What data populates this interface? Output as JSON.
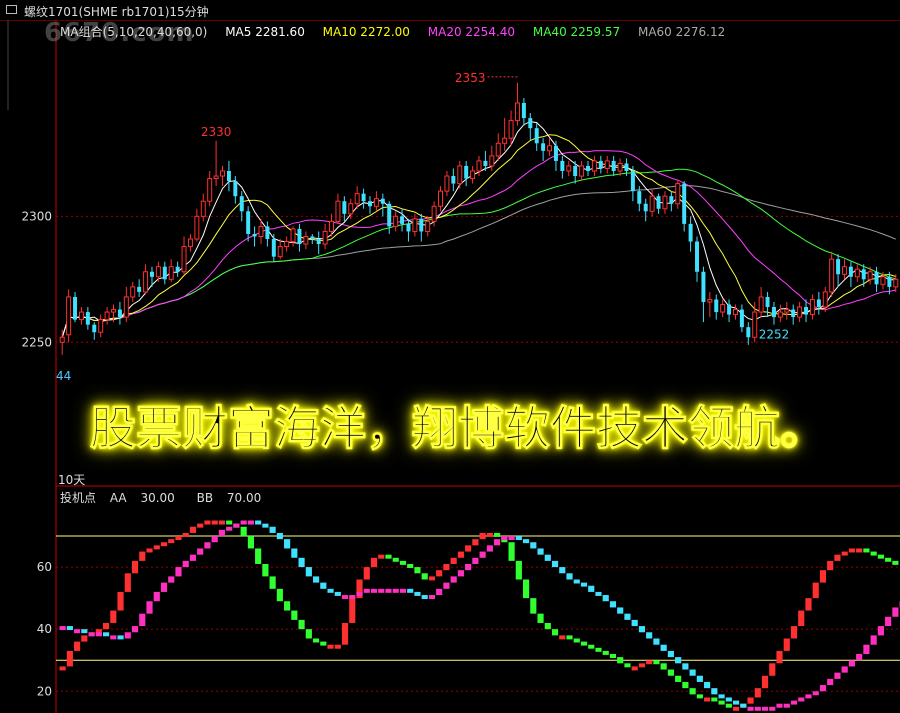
{
  "window": {
    "title": "螺纹1701(SHME rb1701)15分钟"
  },
  "watermark": "6670.com",
  "ma_legend": {
    "group_label": "MA组合(5,10,20,40,60,0)",
    "ma5": "MA5 2281.60",
    "ma10": "MA10 2272.00",
    "ma20": "MA20 2254.40",
    "ma40": "MA40 2259.57",
    "ma60": "MA60 2276.12"
  },
  "colors": {
    "up": "#ff3030",
    "down": "#40e0ff",
    "ma5": "#ffffff",
    "ma10": "#ffff40",
    "ma20": "#ff40ff",
    "ma40": "#40ff40",
    "ma60": "#a0a0a0",
    "axis": "#cc0000",
    "grid_dot": "#990000"
  },
  "banner_text": "股票财富海洋，翔博软件技术领航。",
  "days_label": "10天",
  "left_edge_tick": "44",
  "indicator_legend": {
    "name": "投机点",
    "aa_label": "AA",
    "aa_value": "30.00",
    "bb_label": "BB",
    "bb_value": "70.00"
  },
  "chart_data": [
    {
      "type": "candlestick",
      "title": "螺纹1701(SHME rb1701)15分钟",
      "y_ticks": [
        "2300",
        "2250"
      ],
      "ylim": [
        2239,
        2370
      ],
      "annotations": [
        {
          "label": "2330",
          "bar": 24
        },
        {
          "label": "2353",
          "bar": 71
        },
        {
          "label": "2252",
          "bar": 111
        }
      ],
      "candles": [
        [
          2250,
          2252,
          2245,
          2255
        ],
        [
          2253,
          2268,
          2250,
          2271
        ],
        [
          2268,
          2259,
          2258,
          2270
        ],
        [
          2259,
          2262,
          2257,
          2264
        ],
        [
          2262,
          2257,
          2255,
          2264
        ],
        [
          2257,
          2254,
          2251,
          2258
        ],
        [
          2254,
          2259,
          2252,
          2261
        ],
        [
          2259,
          2262,
          2257,
          2264
        ],
        [
          2262,
          2263,
          2258,
          2265
        ],
        [
          2263,
          2260,
          2257,
          2266
        ],
        [
          2260,
          2268,
          2258,
          2272
        ],
        [
          2268,
          2272,
          2266,
          2274
        ],
        [
          2272,
          2270,
          2268,
          2275
        ],
        [
          2270,
          2278,
          2269,
          2281
        ],
        [
          2278,
          2276,
          2272,
          2280
        ],
        [
          2276,
          2280,
          2274,
          2282
        ],
        [
          2280,
          2275,
          2273,
          2282
        ],
        [
          2275,
          2280,
          2274,
          2283
        ],
        [
          2280,
          2278,
          2276,
          2282
        ],
        [
          2278,
          2288,
          2277,
          2292
        ],
        [
          2288,
          2291,
          2286,
          2293
        ],
        [
          2291,
          2300,
          2290,
          2303
        ],
        [
          2300,
          2306,
          2298,
          2309
        ],
        [
          2306,
          2315,
          2304,
          2318
        ],
        [
          2315,
          2316,
          2312,
          2330
        ],
        [
          2316,
          2318,
          2312,
          2320
        ],
        [
          2318,
          2314,
          2310,
          2322
        ],
        [
          2314,
          2308,
          2305,
          2316
        ],
        [
          2308,
          2302,
          2298,
          2310
        ],
        [
          2302,
          2293,
          2290,
          2304
        ],
        [
          2293,
          2292,
          2288,
          2296
        ],
        [
          2292,
          2296,
          2289,
          2299
        ],
        [
          2296,
          2291,
          2288,
          2298
        ],
        [
          2291,
          2284,
          2282,
          2293
        ],
        [
          2284,
          2288,
          2283,
          2291
        ],
        [
          2288,
          2290,
          2286,
          2292
        ],
        [
          2290,
          2295,
          2288,
          2296
        ],
        [
          2295,
          2289,
          2286,
          2297
        ],
        [
          2289,
          2292,
          2287,
          2294
        ],
        [
          2292,
          2291,
          2289,
          2293
        ],
        [
          2291,
          2289,
          2285,
          2294
        ],
        [
          2289,
          2294,
          2287,
          2297
        ],
        [
          2294,
          2298,
          2292,
          2301
        ],
        [
          2298,
          2306,
          2297,
          2309
        ],
        [
          2306,
          2301,
          2298,
          2308
        ],
        [
          2301,
          2305,
          2299,
          2307
        ],
        [
          2305,
          2309,
          2303,
          2312
        ],
        [
          2309,
          2306,
          2303,
          2311
        ],
        [
          2306,
          2304,
          2301,
          2308
        ],
        [
          2304,
          2307,
          2302,
          2310
        ],
        [
          2307,
          2305,
          2300,
          2309
        ],
        [
          2305,
          2296,
          2293,
          2306
        ],
        [
          2296,
          2300,
          2294,
          2302
        ],
        [
          2300,
          2297,
          2294,
          2303
        ],
        [
          2297,
          2294,
          2290,
          2299
        ],
        [
          2294,
          2299,
          2292,
          2301
        ],
        [
          2299,
          2294,
          2290,
          2301
        ],
        [
          2294,
          2298,
          2292,
          2300
        ],
        [
          2298,
          2304,
          2296,
          2306
        ],
        [
          2304,
          2310,
          2302,
          2312
        ],
        [
          2310,
          2316,
          2308,
          2318
        ],
        [
          2316,
          2313,
          2310,
          2319
        ],
        [
          2313,
          2320,
          2311,
          2322
        ],
        [
          2320,
          2315,
          2312,
          2322
        ],
        [
          2315,
          2318,
          2313,
          2320
        ],
        [
          2318,
          2322,
          2316,
          2324
        ],
        [
          2322,
          2320,
          2318,
          2326
        ],
        [
          2320,
          2324,
          2318,
          2328
        ],
        [
          2324,
          2329,
          2322,
          2333
        ],
        [
          2329,
          2331,
          2326,
          2339
        ],
        [
          2331,
          2338,
          2328,
          2342
        ],
        [
          2338,
          2345,
          2336,
          2353
        ],
        [
          2345,
          2339,
          2336,
          2347
        ],
        [
          2339,
          2335,
          2330,
          2341
        ],
        [
          2335,
          2329,
          2326,
          2337
        ],
        [
          2329,
          2326,
          2322,
          2331
        ],
        [
          2326,
          2328,
          2324,
          2331
        ],
        [
          2328,
          2322,
          2318,
          2330
        ],
        [
          2322,
          2318,
          2315,
          2324
        ],
        [
          2318,
          2320,
          2316,
          2322
        ],
        [
          2320,
          2316,
          2313,
          2322
        ],
        [
          2316,
          2320,
          2314,
          2322
        ],
        [
          2320,
          2318,
          2316,
          2322
        ],
        [
          2318,
          2322,
          2316,
          2324
        ],
        [
          2322,
          2319,
          2317,
          2324
        ],
        [
          2319,
          2322,
          2317,
          2324
        ],
        [
          2322,
          2318,
          2316,
          2324
        ],
        [
          2318,
          2321,
          2316,
          2323
        ],
        [
          2321,
          2318,
          2316,
          2323
        ],
        [
          2318,
          2310,
          2306,
          2320
        ],
        [
          2310,
          2305,
          2302,
          2312
        ],
        [
          2305,
          2302,
          2298,
          2307
        ],
        [
          2302,
          2308,
          2300,
          2311
        ],
        [
          2308,
          2303,
          2301,
          2309
        ],
        [
          2303,
          2308,
          2301,
          2310
        ],
        [
          2308,
          2305,
          2302,
          2310
        ],
        [
          2305,
          2313,
          2303,
          2314
        ],
        [
          2313,
          2297,
          2294,
          2314
        ],
        [
          2297,
          2290,
          2286,
          2300
        ],
        [
          2290,
          2278,
          2274,
          2292
        ],
        [
          2278,
          2266,
          2258,
          2280
        ],
        [
          2266,
          2267,
          2260,
          2270
        ],
        [
          2267,
          2262,
          2259,
          2269
        ],
        [
          2262,
          2265,
          2260,
          2267
        ],
        [
          2265,
          2261,
          2258,
          2267
        ],
        [
          2261,
          2263,
          2259,
          2265
        ],
        [
          2263,
          2256,
          2254,
          2265
        ],
        [
          2256,
          2252,
          2249,
          2258
        ],
        [
          2252,
          2262,
          2250,
          2266
        ],
        [
          2262,
          2268,
          2260,
          2272
        ],
        [
          2268,
          2264,
          2260,
          2270
        ],
        [
          2264,
          2260,
          2257,
          2266
        ],
        [
          2260,
          2262,
          2258,
          2265
        ],
        [
          2262,
          2263,
          2259,
          2266
        ],
        [
          2263,
          2260,
          2257,
          2265
        ],
        [
          2260,
          2264,
          2258,
          2266
        ],
        [
          2264,
          2261,
          2258,
          2267
        ],
        [
          2261,
          2267,
          2259,
          2269
        ],
        [
          2267,
          2264,
          2261,
          2270
        ],
        [
          2264,
          2270,
          2262,
          2272
        ],
        [
          2270,
          2283,
          2268,
          2286
        ],
        [
          2283,
          2277,
          2272,
          2285
        ],
        [
          2277,
          2280,
          2275,
          2283
        ],
        [
          2280,
          2276,
          2272,
          2282
        ],
        [
          2276,
          2279,
          2274,
          2281
        ],
        [
          2279,
          2275,
          2272,
          2281
        ],
        [
          2275,
          2278,
          2273,
          2280
        ],
        [
          2278,
          2273,
          2270,
          2280
        ],
        [
          2273,
          2276,
          2271,
          2278
        ],
        [
          2276,
          2272,
          2269,
          2278
        ],
        [
          2272,
          2275,
          2270,
          2277
        ]
      ]
    },
    {
      "type": "line",
      "title": "投机点",
      "y_ticks": [
        "60",
        "40",
        "20"
      ],
      "ylim": [
        13,
        80
      ],
      "reference_lines": [
        30,
        70
      ],
      "series": [
        {
          "name": "AA",
          "color": "#ff2040",
          "values": [
            28,
            33,
            36,
            38,
            39,
            40,
            42,
            46,
            52,
            58,
            62,
            65,
            66,
            67,
            68,
            69,
            70,
            71,
            73,
            74,
            75,
            75,
            75,
            74,
            73,
            70,
            66,
            61,
            57,
            53,
            49,
            46,
            43,
            40,
            37,
            36,
            35,
            35,
            35,
            42,
            50,
            56,
            60,
            63,
            64,
            63,
            62,
            61,
            60,
            58,
            56,
            57,
            59,
            61,
            63,
            65,
            67,
            69,
            71,
            71,
            70,
            68,
            62,
            56,
            50,
            45,
            42,
            40,
            38,
            38,
            37,
            36,
            35,
            34,
            33,
            32,
            31,
            29,
            28,
            28,
            29,
            30,
            29,
            27,
            25,
            23,
            21,
            19,
            18,
            18,
            17,
            16,
            15,
            15,
            16,
            18,
            21,
            25,
            29,
            33,
            37,
            41,
            46,
            50,
            55,
            59,
            62,
            64,
            65,
            66,
            66,
            65,
            64,
            63,
            62,
            61
          ]
        },
        {
          "name": "BB",
          "color": "#ff30c0",
          "values": [
            41,
            40,
            40,
            39,
            39,
            39,
            38,
            38,
            37,
            39,
            41,
            45,
            49,
            52,
            55,
            57,
            60,
            62,
            64,
            66,
            68,
            70,
            72,
            73,
            74,
            75,
            75,
            74,
            73,
            71,
            69,
            66,
            63,
            60,
            57,
            55,
            53,
            52,
            51,
            51,
            51,
            52,
            53,
            53,
            53,
            53,
            53,
            53,
            52,
            51,
            50,
            51,
            53,
            55,
            57,
            59,
            61,
            63,
            65,
            67,
            69,
            70,
            70,
            69,
            68,
            66,
            64,
            62,
            60,
            58,
            56,
            55,
            54,
            52,
            51,
            49,
            47,
            45,
            43,
            41,
            39,
            37,
            35,
            33,
            31,
            29,
            27,
            25,
            23,
            21,
            19,
            18,
            17,
            16,
            15,
            15,
            15,
            15,
            15,
            16,
            16,
            17,
            18,
            19,
            20,
            22,
            24,
            26,
            28,
            30,
            32,
            35,
            38,
            41,
            44,
            47,
            49
          ]
        }
      ]
    }
  ]
}
